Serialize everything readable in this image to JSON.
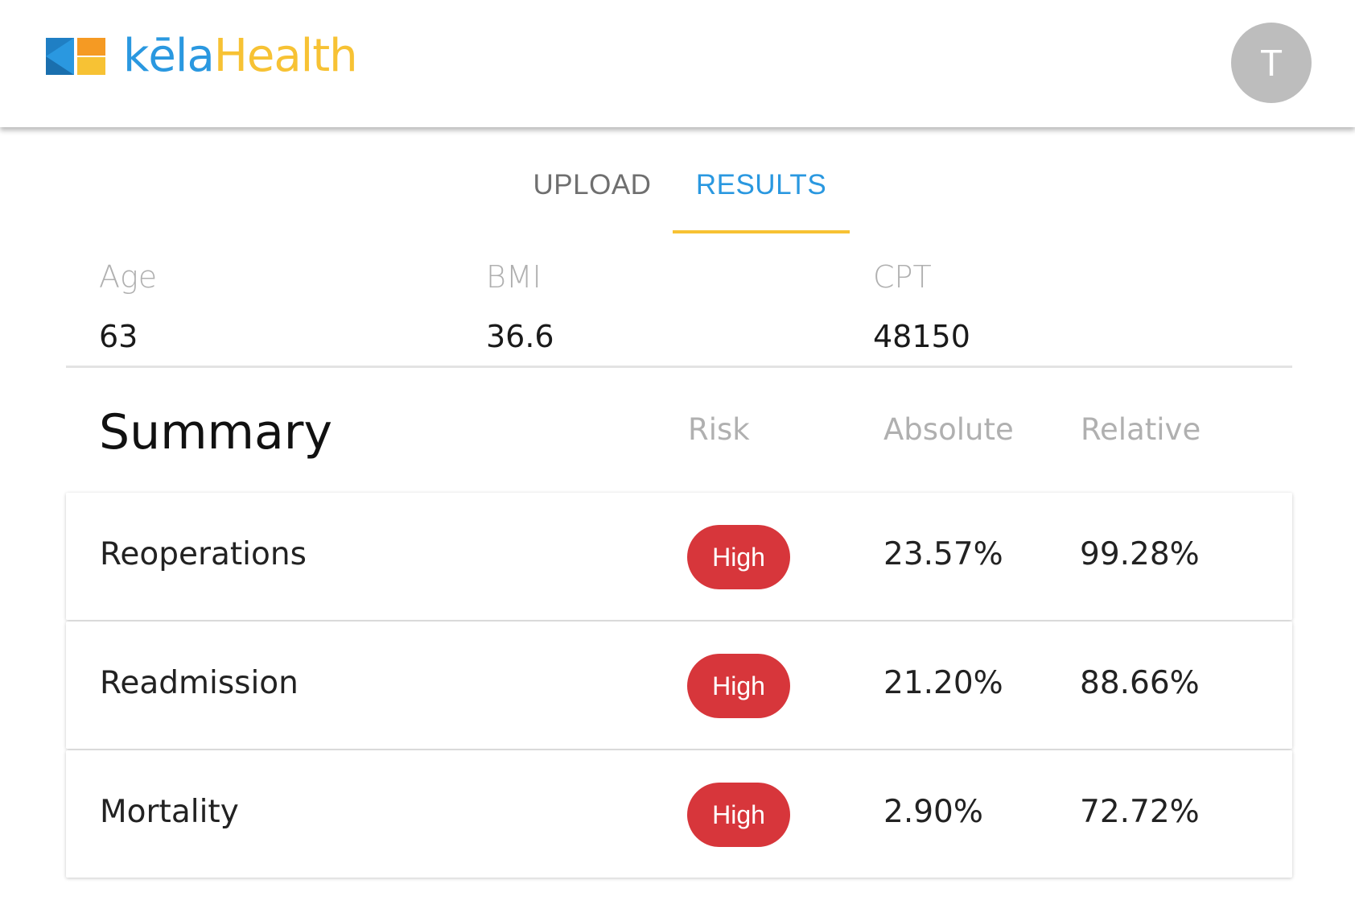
{
  "brand": {
    "name_part1": "kēla",
    "name_part2": "Health",
    "accent": "#2a98e0",
    "highlight": "#f7c234",
    "logo_icon": "kela-logo-icon"
  },
  "user": {
    "avatar_initial": "T"
  },
  "tabs": [
    {
      "label": "UPLOAD",
      "active": false
    },
    {
      "label": "RESULTS",
      "active": true
    }
  ],
  "patient": {
    "age": {
      "label": "Age",
      "value": "63"
    },
    "bmi": {
      "label": "BMI",
      "value": "36.6"
    },
    "cpt": {
      "label": "CPT",
      "value": "48150"
    }
  },
  "summary": {
    "title": "Summary",
    "columns": {
      "risk": "Risk",
      "absolute": "Absolute",
      "relative": "Relative"
    },
    "risk_color": "#d7363b",
    "rows": [
      {
        "name": "Reoperations",
        "risk": "High",
        "absolute": "23.57%",
        "relative": "99.28%"
      },
      {
        "name": "Readmission",
        "risk": "High",
        "absolute": "21.20%",
        "relative": "88.66%"
      },
      {
        "name": "Mortality",
        "risk": "High",
        "absolute": "2.90%",
        "relative": "72.72%"
      }
    ]
  }
}
